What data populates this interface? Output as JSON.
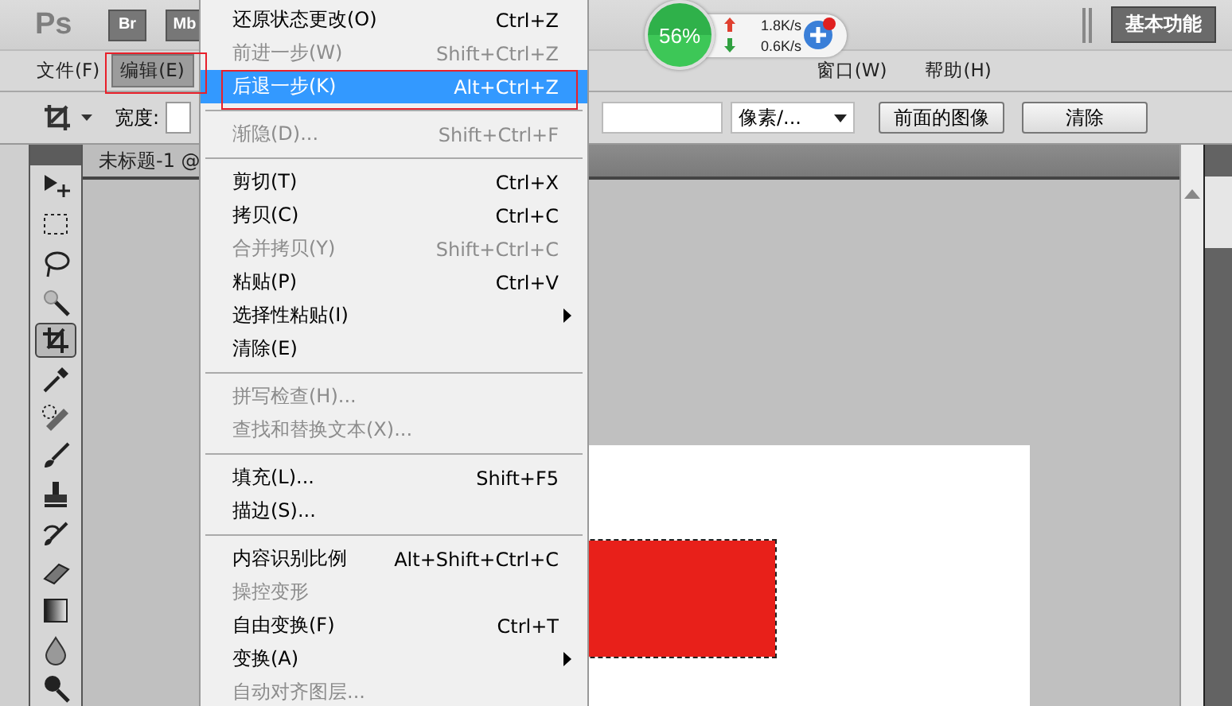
{
  "title_bar": {
    "logo": "Ps",
    "apps": [
      "Br",
      "Mb"
    ],
    "workspace_button": "基本功能"
  },
  "menu_bar": [
    {
      "label": "文件(F)",
      "selected": false
    },
    {
      "label": "编辑(E)",
      "selected": true
    },
    {
      "label": "窗口(W)",
      "selected": false
    },
    {
      "label": "帮助(H)",
      "selected": false
    }
  ],
  "network_widget": {
    "percent": "56%",
    "upload": "1.8K/s",
    "download": "0.6K/s"
  },
  "options_bar": {
    "width_label": "宽度:",
    "unit_select": "像素/...",
    "buttons": [
      "前面的图像",
      "清除"
    ]
  },
  "document_tab": "未标题-1 @",
  "toolbox": [
    {
      "kind": "move",
      "selected": false
    },
    {
      "kind": "marquee",
      "selected": false
    },
    {
      "kind": "lasso",
      "selected": false
    },
    {
      "kind": "wand",
      "selected": false
    },
    {
      "kind": "crop",
      "selected": true
    },
    {
      "kind": "eyedropper",
      "selected": false
    },
    {
      "kind": "bandage",
      "selected": false
    },
    {
      "kind": "brush",
      "selected": false
    },
    {
      "kind": "stamp",
      "selected": false
    },
    {
      "kind": "history",
      "selected": false
    },
    {
      "kind": "eraser",
      "selected": false
    },
    {
      "kind": "gradient",
      "selected": false
    },
    {
      "kind": "drop",
      "selected": false
    },
    {
      "kind": "dodge",
      "selected": false
    }
  ],
  "edit_menu": [
    {
      "kind": "item",
      "label": "还原状态更改(O)",
      "shortcut": "Ctrl+Z",
      "disabled": false,
      "selected": false,
      "submenu": false
    },
    {
      "kind": "item",
      "label": "前进一步(W)",
      "shortcut": "Shift+Ctrl+Z",
      "disabled": true,
      "selected": false,
      "submenu": false
    },
    {
      "kind": "item",
      "label": "后退一步(K)",
      "shortcut": "Alt+Ctrl+Z",
      "disabled": false,
      "selected": true,
      "submenu": false
    },
    {
      "kind": "separator"
    },
    {
      "kind": "item",
      "label": "渐隐(D)...",
      "shortcut": "Shift+Ctrl+F",
      "disabled": true,
      "selected": false,
      "submenu": false
    },
    {
      "kind": "separator"
    },
    {
      "kind": "item",
      "label": "剪切(T)",
      "shortcut": "Ctrl+X",
      "disabled": false,
      "selected": false,
      "submenu": false
    },
    {
      "kind": "item",
      "label": "拷贝(C)",
      "shortcut": "Ctrl+C",
      "disabled": false,
      "selected": false,
      "submenu": false
    },
    {
      "kind": "item",
      "label": "合并拷贝(Y)",
      "shortcut": "Shift+Ctrl+C",
      "disabled": true,
      "selected": false,
      "submenu": false
    },
    {
      "kind": "item",
      "label": "粘贴(P)",
      "shortcut": "Ctrl+V",
      "disabled": false,
      "selected": false,
      "submenu": false
    },
    {
      "kind": "item",
      "label": "选择性粘贴(I)",
      "disabled": false,
      "selected": false,
      "submenu": true
    },
    {
      "kind": "item",
      "label": "清除(E)",
      "disabled": false,
      "selected": false,
      "submenu": false
    },
    {
      "kind": "separator"
    },
    {
      "kind": "item",
      "label": "拼写检查(H)...",
      "disabled": true,
      "selected": false,
      "submenu": false
    },
    {
      "kind": "item",
      "label": "查找和替换文本(X)...",
      "disabled": true,
      "selected": false,
      "submenu": false
    },
    {
      "kind": "separator"
    },
    {
      "kind": "item",
      "label": "填充(L)...",
      "shortcut": "Shift+F5",
      "disabled": false,
      "selected": false,
      "submenu": false
    },
    {
      "kind": "item",
      "label": "描边(S)...",
      "disabled": false,
      "selected": false,
      "submenu": false
    },
    {
      "kind": "separator"
    },
    {
      "kind": "item",
      "label": "内容识别比例",
      "shortcut": "Alt+Shift+Ctrl+C",
      "disabled": false,
      "selected": false,
      "submenu": false
    },
    {
      "kind": "item",
      "label": "操控变形",
      "disabled": true,
      "selected": false,
      "submenu": false
    },
    {
      "kind": "item",
      "label": "自由变换(F)",
      "shortcut": "Ctrl+T",
      "disabled": false,
      "selected": false,
      "submenu": false
    },
    {
      "kind": "item",
      "label": "变换(A)",
      "disabled": false,
      "selected": false,
      "submenu": true
    },
    {
      "kind": "item",
      "label": "自动对齐图层...",
      "disabled": true,
      "selected": false,
      "submenu": false
    }
  ]
}
